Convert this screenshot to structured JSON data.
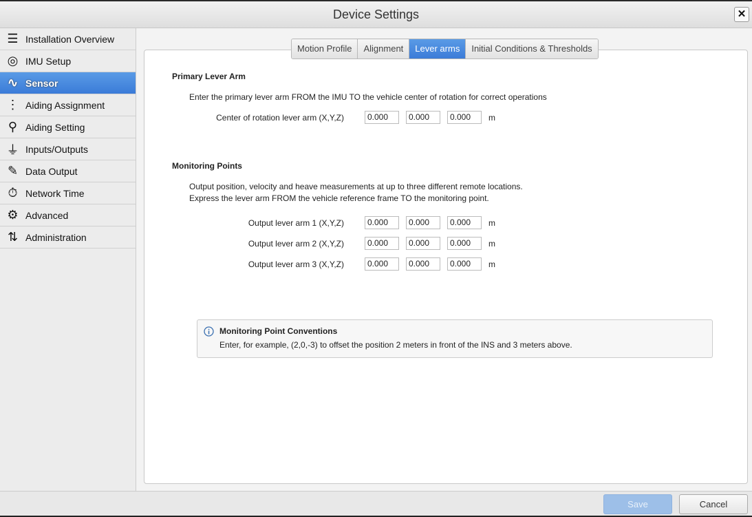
{
  "window": {
    "title": "Device Settings"
  },
  "sidebar": {
    "items": [
      {
        "label": "Installation Overview",
        "icon": "checklist-icon"
      },
      {
        "label": "IMU Setup",
        "icon": "imu-icon"
      },
      {
        "label": "Sensor",
        "icon": "waveform-icon",
        "active": true
      },
      {
        "label": "Aiding Assignment",
        "icon": "tree-icon"
      },
      {
        "label": "Aiding Setting",
        "icon": "location-pin-icon"
      },
      {
        "label": "Inputs/Outputs",
        "icon": "plug-icon"
      },
      {
        "label": "Data Output",
        "icon": "document-pen-icon"
      },
      {
        "label": "Network Time",
        "icon": "stopwatch-icon"
      },
      {
        "label": "Advanced",
        "icon": "gear-icon"
      },
      {
        "label": "Administration",
        "icon": "arrows-icon"
      }
    ]
  },
  "tabs": [
    "Motion Profile",
    "Alignment",
    "Lever arms",
    "Initial Conditions & Thresholds"
  ],
  "primary": {
    "heading": "Primary Lever Arm",
    "desc": "Enter the primary lever arm FROM the IMU TO the vehicle center of rotation for correct operations",
    "label": "Center of rotation lever arm (X,Y,Z)",
    "values": [
      "0.000",
      "0.000",
      "0.000"
    ],
    "unit": "m"
  },
  "monitoring": {
    "heading": "Monitoring Points",
    "desc1": "Output position, velocity and heave measurements at up to three different remote locations.",
    "desc2": "Express the lever arm FROM the vehicle reference frame TO the monitoring point.",
    "rows": [
      {
        "label": "Output lever arm 1 (X,Y,Z)",
        "values": [
          "0.000",
          "0.000",
          "0.000"
        ],
        "unit": "m"
      },
      {
        "label": "Output lever arm 2 (X,Y,Z)",
        "values": [
          "0.000",
          "0.000",
          "0.000"
        ],
        "unit": "m"
      },
      {
        "label": "Output lever arm 3 (X,Y,Z)",
        "values": [
          "0.000",
          "0.000",
          "0.000"
        ],
        "unit": "m"
      }
    ]
  },
  "info": {
    "title": "Monitoring Point Conventions",
    "text": "Enter, for example, (2,0,-3) to offset the position 2 meters in front of the INS and 3 meters above."
  },
  "footer": {
    "save": "Save",
    "cancel": "Cancel"
  }
}
